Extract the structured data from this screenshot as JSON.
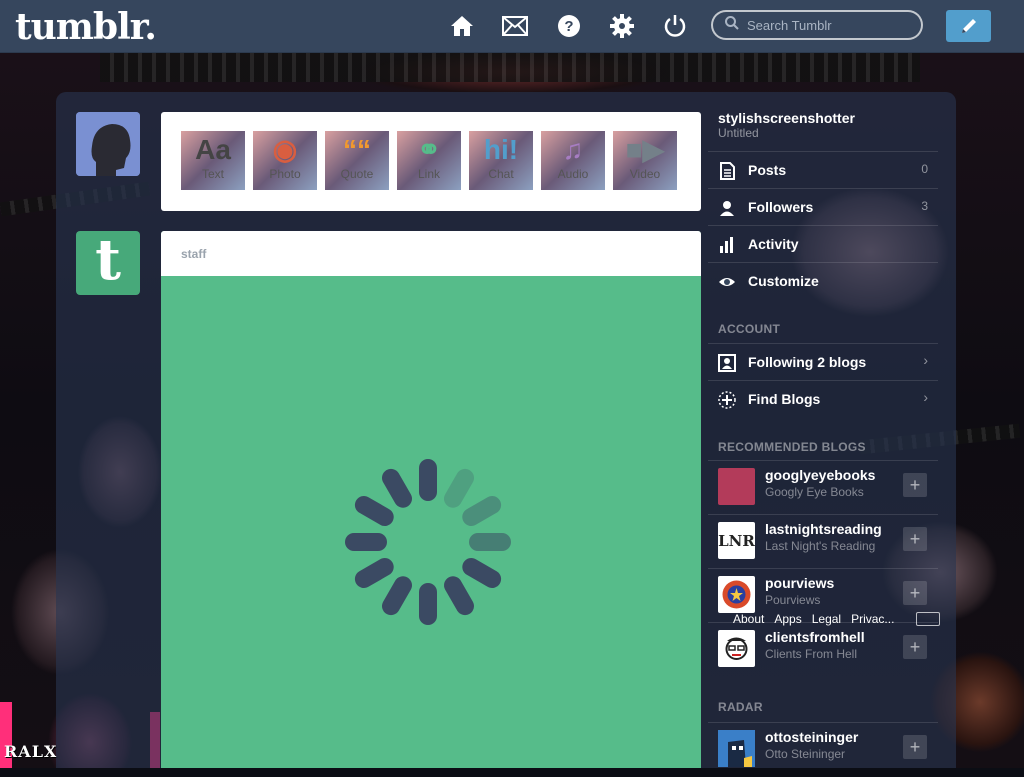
{
  "brand": {
    "logo": "tumblr."
  },
  "nav": {
    "icons": [
      "home-icon",
      "mail-icon",
      "help-icon",
      "settings-icon",
      "power-icon"
    ],
    "search_placeholder": "Search Tumblr"
  },
  "post_form": {
    "buttons": [
      {
        "label": "Text",
        "glyph": "Aa",
        "color": "#444444"
      },
      {
        "label": "Photo",
        "glyph": "◉",
        "color": "#d95e40"
      },
      {
        "label": "Quote",
        "glyph": "““",
        "color": "#f2992e"
      },
      {
        "label": "Link",
        "glyph": "⚭",
        "color": "#56bc8a"
      },
      {
        "label": "Chat",
        "glyph": "hi!",
        "color": "#529ecc"
      },
      {
        "label": "Audio",
        "glyph": "♫",
        "color": "#a77dc2"
      },
      {
        "label": "Video",
        "glyph": "■▶",
        "color": "#748089"
      }
    ]
  },
  "post": {
    "blog_name": "staff"
  },
  "sidebar": {
    "blog_name": "stylishscreenshotter",
    "blog_title": "Untitled",
    "menu": [
      {
        "label": "Posts",
        "count": "0"
      },
      {
        "label": "Followers",
        "count": "3"
      },
      {
        "label": "Activity",
        "count": ""
      },
      {
        "label": "Customize",
        "count": ""
      }
    ],
    "account_header": "ACCOUNT",
    "account": [
      {
        "label": "Following 2 blogs"
      },
      {
        "label": "Find Blogs"
      }
    ],
    "recommended_header": "RECOMMENDED BLOGS",
    "recommended": [
      {
        "name": "googlyeyebooks",
        "title": "Googly Eye Books"
      },
      {
        "name": "lastnightsreading",
        "title": "Last Night's Reading"
      },
      {
        "name": "pourviews",
        "title": "Pourviews"
      },
      {
        "name": "clientsfromhell",
        "title": "Clients From Hell"
      }
    ],
    "radar_header": "RADAR",
    "radar": [
      {
        "name": "ottosteininger",
        "title": "Otto Steininger"
      }
    ],
    "footer": [
      "About",
      "Apps",
      "Legal",
      "Privac..."
    ]
  },
  "colors": {
    "topbar": "#36465d",
    "post_bg": "#56bc8a",
    "compose": "#529ecc",
    "spinner": "#3b4a63"
  },
  "background_text": {
    "watermark": "RALX"
  }
}
